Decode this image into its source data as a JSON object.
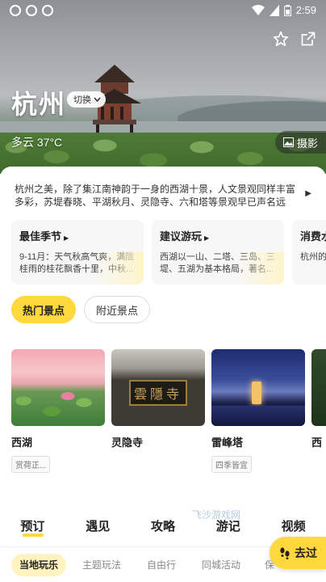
{
  "status_bar": {
    "time": "2:59"
  },
  "hero": {
    "city": "杭州",
    "switch_label": "切换",
    "weather": "多云 37°C",
    "photo_label": "摄影"
  },
  "intro": {
    "text": "杭州之美，除了集江南神韵于一身的西湖十景，人文景观同样丰富多彩，苏堤春晓、平湖秋月、灵隐寺、六和塔等景观早已声名远播。..."
  },
  "info_cards": [
    {
      "title": "最佳季节",
      "body": "9-11月：天气秋高气爽，满陇桂雨的桂花飘香十里，中秋..."
    },
    {
      "title": "建议游玩",
      "body": "西湖以一山、二塔、三岛、三堤、五湖为基本格局，著名..."
    },
    {
      "title": "消费水",
      "body": "杭州的消等国内一..."
    }
  ],
  "chips": {
    "hot": "热门景点",
    "nearby": "附近景点"
  },
  "spots": [
    {
      "name": "西湖",
      "tag": "赏荷正..."
    },
    {
      "name": "灵隐寺",
      "board": "雲隱寺",
      "tag": ""
    },
    {
      "name": "雷峰塔",
      "tag": "四季皆宜"
    },
    {
      "name": "西"
    }
  ],
  "main_tabs": [
    "预订",
    "遇见",
    "攻略",
    "游记",
    "视频"
  ],
  "watermark": "飞沙游戏网",
  "sub_tabs": [
    "当地玩乐",
    "主题玩法",
    "自由行",
    "同城活动",
    "保"
  ],
  "go_button": "去过",
  "colors": {
    "accent": "#ffd83d",
    "accent_light": "#fff3c0"
  }
}
